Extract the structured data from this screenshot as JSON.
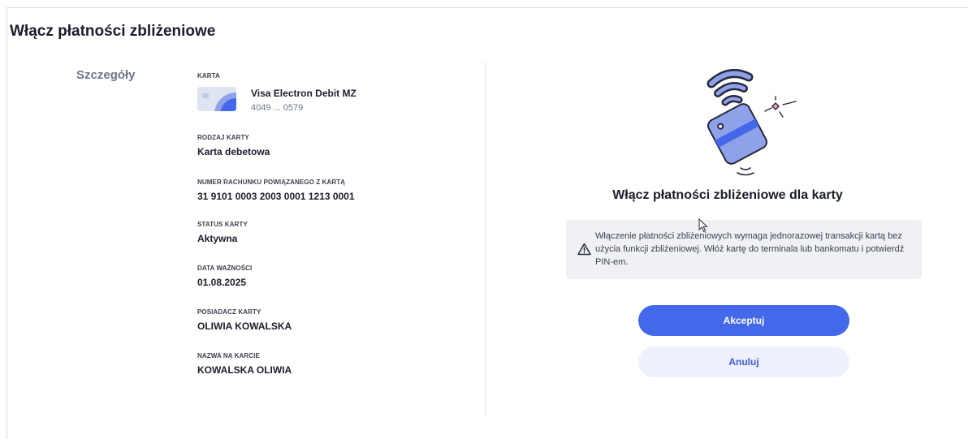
{
  "page": {
    "title": "Włącz płatności zbliżeniowe"
  },
  "details": {
    "section_title": "Szczegóły",
    "card": {
      "label": "KARTA",
      "name": "Visa Electron Debit MZ",
      "number": "4049 ... 0579"
    },
    "fields": [
      {
        "label": "RODZAJ KARTY",
        "value": "Karta debetowa"
      },
      {
        "label": "NUMER RACHUNKU POWIĄZANEGO Z KARTĄ",
        "value": "31 9101 0003 2003 0001 1213 0001"
      },
      {
        "label": "STATUS KARTY",
        "value": "Aktywna"
      },
      {
        "label": "DATA WAŻNOŚCI",
        "value": "01.08.2025"
      },
      {
        "label": "POSIADACZ KARTY",
        "value": "OLIWIA KOWALSKA"
      },
      {
        "label": "NAZWA NA KARCIE",
        "value": "KOWALSKA OLIWIA"
      }
    ]
  },
  "right": {
    "illustration_icon": "contactless-card-icon",
    "title": "Włącz płatności zbliżeniowe dla karty",
    "info": {
      "icon": "warning-icon",
      "text": "Włączenie płatności zbliżeniowych wymaga jednorazowej transakcji kartą bez użycia funkcji zbliżeniowej. Włóż kartę do terminala lub bankomatu i potwierdź PIN-em."
    },
    "accept_label": "Akceptuj",
    "cancel_label": "Anuluj"
  },
  "colors": {
    "accent": "#4368ea",
    "secondary_button_bg": "#eef1fb",
    "info_bg": "#f0f1f4",
    "section_title": "#6f7689"
  }
}
